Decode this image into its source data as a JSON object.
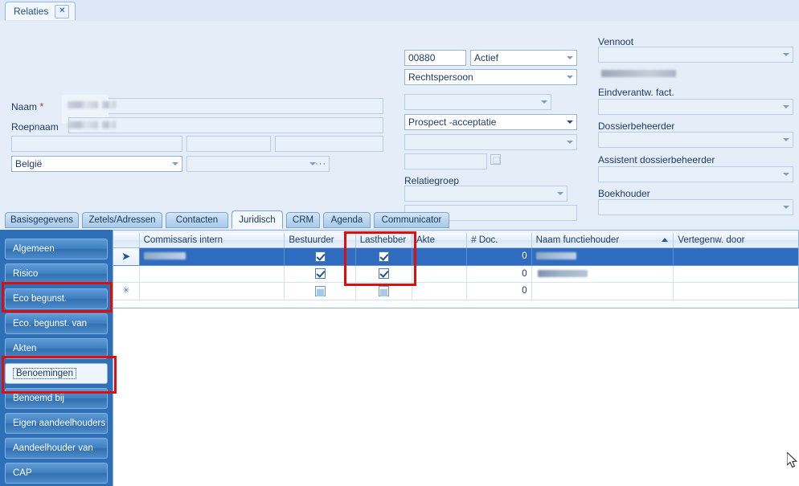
{
  "window": {
    "tab_label": "Relaties",
    "close_label": "✕"
  },
  "form": {
    "labels": {
      "naam": "Naam",
      "required_marker": "*",
      "roepnaam": "Roepnaam",
      "relatiegroep": "Relatiegroep",
      "vennoot": "Vennoot",
      "eindverantw": "Eindverantw. fact.",
      "dossierbeheerder": "Dossierbeheerder",
      "assistent": "Assistent dossierbeheerder",
      "boekhouder": "Boekhouder"
    },
    "values": {
      "naam": "",
      "roepnaam": "",
      "street": "",
      "housenr": "",
      "box": "",
      "country": "België",
      "city": "",
      "relatienummer": "00880",
      "status": "Actief",
      "rechtsvorm": "Rechtspersoon",
      "empty_combo_1": "",
      "prospect": "Prospect -acceptatie",
      "empty_combo_2": "",
      "small_text": "",
      "relatiegroep": "",
      "relatiegroep_extra": "",
      "vennoot": "",
      "eindverantw": "",
      "dossierbeheerder": "",
      "assistent": "",
      "boekhouder": ""
    },
    "ellipsis_label": "···"
  },
  "section_tabs": [
    {
      "label": "Basisgegevens",
      "active": false
    },
    {
      "label": "Zetels/Adressen",
      "active": false
    },
    {
      "label": "Contacten",
      "active": false
    },
    {
      "label": "Juridisch",
      "active": true
    },
    {
      "label": "CRM",
      "active": false
    },
    {
      "label": "Agenda",
      "active": false
    },
    {
      "label": "Communicator",
      "active": false
    }
  ],
  "sidebar": {
    "items": [
      {
        "label": "Algemeen",
        "focused": false
      },
      {
        "label": "Risico",
        "focused": false
      },
      {
        "label": "Eco begunst.",
        "focused": false
      },
      {
        "label": "Eco. begunst. van",
        "focused": false
      },
      {
        "label": "Akten",
        "focused": false
      },
      {
        "label": "Benoemingen",
        "focused": true
      },
      {
        "label": "Benoemd bij",
        "focused": false
      },
      {
        "label": "Eigen aandeelhouders",
        "focused": false
      },
      {
        "label": "Aandeelhouder van",
        "focused": false
      },
      {
        "label": "CAP",
        "focused": false
      }
    ]
  },
  "grid": {
    "columns": [
      {
        "label": "",
        "key": "rowhdr"
      },
      {
        "label": "Commissaris intern",
        "key": "commissaris"
      },
      {
        "label": "Bestuurder",
        "key": "bestuurder"
      },
      {
        "label": "Lasthebber",
        "key": "lasthebber"
      },
      {
        "label": "Akte",
        "key": "akte"
      },
      {
        "label": "# Doc.",
        "key": "docs"
      },
      {
        "label": "Naam functiehouder",
        "key": "functiehouder",
        "sorted": "asc"
      },
      {
        "label": "Vertegenw. door",
        "key": "vertegenw"
      }
    ],
    "rows": [
      {
        "indicator": "➤",
        "selected": true,
        "commissaris": "",
        "bestuurder": "checked",
        "lasthebber": "checked",
        "akte": "",
        "docs": "0",
        "functiehouder": "",
        "vertegenw": ""
      },
      {
        "indicator": "",
        "selected": false,
        "commissaris": "",
        "bestuurder": "checked",
        "lasthebber": "checked",
        "akte": "",
        "docs": "0",
        "functiehouder": "",
        "vertegenw": ""
      },
      {
        "indicator": "✳",
        "selected": false,
        "commissaris": "",
        "bestuurder": "indeterminate",
        "lasthebber": "indeterminate",
        "akte": "",
        "docs": "0",
        "functiehouder": "",
        "vertegenw": ""
      }
    ]
  },
  "annotations": {
    "highlight_color": "#e00d0d",
    "boxes": [
      {
        "name": "lasthebber-column-highlight"
      },
      {
        "name": "eco-begunst-nav-highlight"
      },
      {
        "name": "benoemingen-nav-highlight"
      }
    ]
  },
  "colors": {
    "accent_blue": "#2f6cbf",
    "panel_bg": "#e5edf8",
    "nav_bg": "#2e6fb7",
    "required_red": "#d0342c"
  }
}
